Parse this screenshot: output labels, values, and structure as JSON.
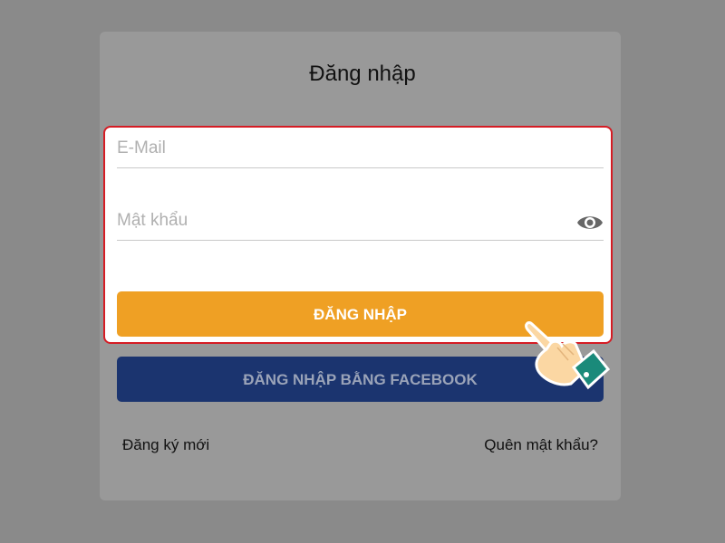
{
  "login_form": {
    "title": "Đăng nhập",
    "email_placeholder": "E-Mail",
    "password_placeholder": "Mật khẩu",
    "login_button": "ĐĂNG NHẬP",
    "facebook_button": "ĐĂNG NHẬP BẰNG FACEBOOK",
    "register_link": "Đăng ký mới",
    "forgot_link": "Quên mật khẩu?"
  },
  "icons": {
    "password_toggle": "eye-icon",
    "pointer": "pointing-hand-icon"
  },
  "colors": {
    "login_button": "#efa024",
    "facebook_button": "#1b346f",
    "highlight_border": "#d51c24"
  }
}
